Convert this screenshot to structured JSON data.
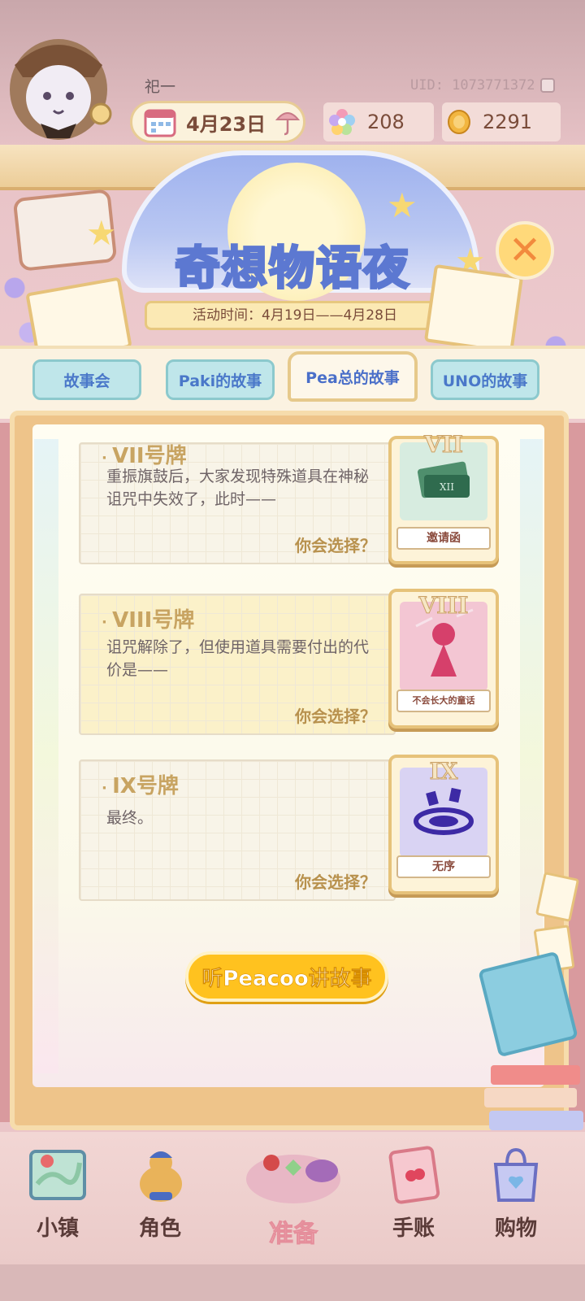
{
  "player": {
    "name": "祀一",
    "uid": "UID: 1073771372"
  },
  "hud": {
    "date": "4月23日",
    "gems": "208",
    "coins": "2291"
  },
  "event": {
    "title": "奇想物语夜",
    "time": "活动时间：4月19日——4月28日"
  },
  "tabs": [
    {
      "label": "故事会",
      "active": false
    },
    {
      "label": "Paki的故事",
      "active": false
    },
    {
      "label": "Pea总的故事",
      "active": true
    },
    {
      "label": "UNO的故事",
      "active": false
    }
  ],
  "stories": [
    {
      "title": "VII号牌",
      "desc": "重振旗鼓后，大家发现特殊道具在神秘诅咒中失效了，此时——",
      "choice": "你会选择？",
      "card_num": "VII",
      "card_label": "邀请函"
    },
    {
      "title": "VIII号牌",
      "desc": "诅咒解除了，但使用道具需要付出的代价是——",
      "choice": "你会选择？",
      "card_num": "VIII",
      "card_label": "不会长大的童话"
    },
    {
      "title": "IX号牌",
      "desc": "最终。",
      "choice": "你会选择？",
      "card_num": "IX",
      "card_label": "无序"
    }
  ],
  "listen_button": "听Peacoo讲故事",
  "nav": [
    {
      "label": "小镇",
      "icon": "map-icon"
    },
    {
      "label": "角色",
      "icon": "character-icon"
    },
    {
      "label": "准备",
      "icon": "prepare-icon"
    },
    {
      "label": "手账",
      "icon": "journal-icon"
    },
    {
      "label": "购物",
      "icon": "shopping-bag-icon"
    }
  ],
  "colors": {
    "accent_yellow": "#ffc21f",
    "tab_blue": "#4a78c9",
    "title_stroke": "#5c78d1"
  }
}
